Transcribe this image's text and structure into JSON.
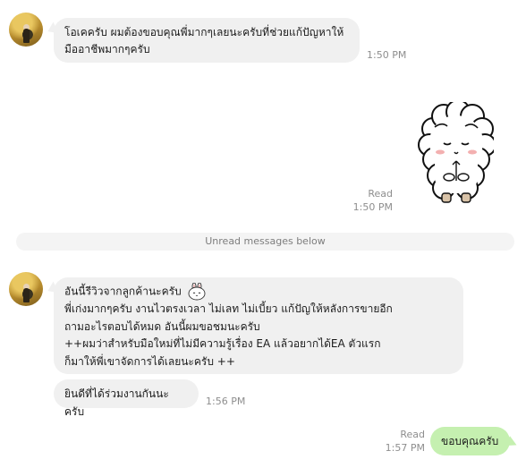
{
  "messages": {
    "m1": {
      "text_line1": "โอเคครับ ผมต้องขอบคุณพี่มากๆเลยนะครับที่ช่วยแก้ปัญหาให้",
      "text_line2": "มืออาชีพมากๆครับ",
      "time": "1:50 PM"
    },
    "m2": {
      "read": "Read",
      "time": "1:50 PM"
    },
    "divider": "Unread messages below",
    "m3": {
      "line1": "อันนี้รีวิวจากลูกค้านะครับ",
      "line2": "พี่เก่งมากๆครับ งานไวตรงเวลา ไม่เลท ไม่เบี้ยว แก้ปัญให้หลังการขายอีก",
      "line3": "ถามอะไรตอบได้หมด อันนี้ผมขอชมนะครับ",
      "line4": "++ผมว่าสำหรับมือใหม่ที่ไม่มีความรู้เรื่อง EA แล้วอยากได้EA ตัวแรก",
      "line5": "ก็มาให้พี่เขาจัดการได้เลยนะครับ ++"
    },
    "m4": {
      "text": "ยินดีที่ได้ร่วมงานกันนะครับ",
      "time": "1:56 PM"
    },
    "m5": {
      "text": "ขอบคุณครับ",
      "read": "Read",
      "time": "1:57 PM"
    }
  },
  "colors": {
    "incoming_bubble": "#f0f0f0",
    "outgoing_bubble": "#c5f0b0",
    "meta_text": "#8e8e8e"
  },
  "icons": {
    "sticker": "white-sheep-bowing-sticker",
    "inline_emoji": "bunny-face-emoji"
  }
}
